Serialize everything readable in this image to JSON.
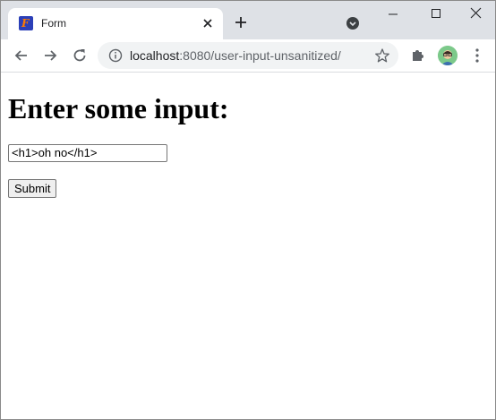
{
  "tab": {
    "title": "Form",
    "favicon_letter": "F"
  },
  "address_bar": {
    "host": "localhost",
    "path": ":8080/user-input-unsanitized/"
  },
  "page": {
    "heading": "Enter some input:",
    "input_value": "<h1>oh no</h1>",
    "submit_label": "Submit"
  },
  "icons": {
    "tab_close": "close-icon",
    "new_tab": "plus-icon",
    "tab_search": "tab-search-icon",
    "minimize": "minimize-icon",
    "maximize": "maximize-icon",
    "window_close": "close-icon",
    "back": "back-arrow-icon",
    "forward": "forward-arrow-icon",
    "reload": "reload-icon",
    "site_info": "info-icon",
    "bookmark": "star-icon",
    "extensions": "puzzle-icon",
    "profile": "avatar",
    "menu": "kebab-menu-icon"
  },
  "colors": {
    "tabstrip_bg": "#dee1e6",
    "omnibox_bg": "#f1f3f4",
    "favicon_bg": "#2b3fb8",
    "favicon_fg": "#ff7a00"
  }
}
